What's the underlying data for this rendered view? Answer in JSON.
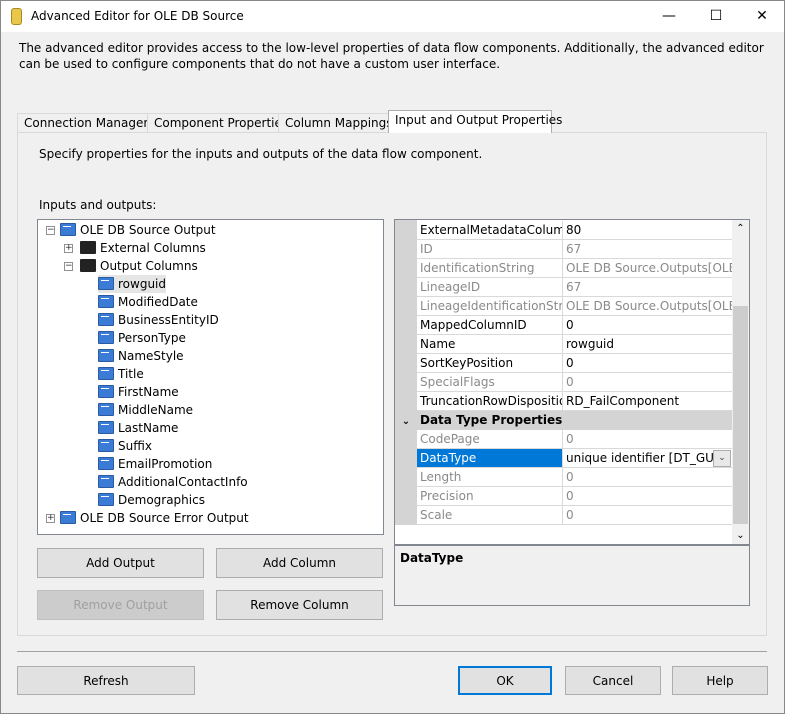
{
  "window": {
    "title": "Advanced Editor for OLE DB Source",
    "minimize": "—",
    "maximize": "☐",
    "close": "✕"
  },
  "description": "The advanced editor provides access to the low-level properties of data flow components. Additionally, the advanced editor can be used to configure components that do not have a custom user interface.",
  "tabs": [
    {
      "label": "Connection Managers"
    },
    {
      "label": "Component Properties"
    },
    {
      "label": "Column Mappings"
    },
    {
      "label": "Input and Output Properties",
      "active": true
    }
  ],
  "page": {
    "instruction": "Specify properties for the inputs and outputs of the data flow component.",
    "tree_label": "Inputs and outputs:"
  },
  "tree": {
    "output": "OLE DB Source Output",
    "external": "External Columns",
    "output_columns": "Output Columns",
    "columns": [
      "rowguid",
      "ModifiedDate",
      "BusinessEntityID",
      "PersonType",
      "NameStyle",
      "Title",
      "FirstName",
      "MiddleName",
      "LastName",
      "Suffix",
      "EmailPromotion",
      "AdditionalContactInfo",
      "Demographics"
    ],
    "error_output": "OLE DB Source Error Output",
    "selected": "rowguid"
  },
  "buttons": {
    "add_output": "Add Output",
    "add_column": "Add Column",
    "remove_output": "Remove Output",
    "remove_column": "Remove Column",
    "refresh": "Refresh",
    "ok": "OK",
    "cancel": "Cancel",
    "help": "Help"
  },
  "properties": [
    {
      "name": "ExternalMetadataColumnID",
      "value": "80",
      "readonly": false
    },
    {
      "name": "ID",
      "value": "67",
      "readonly": true
    },
    {
      "name": "IdentificationString",
      "value": "OLE DB Source.Outputs[OLE DB",
      "readonly": true
    },
    {
      "name": "LineageID",
      "value": "67",
      "readonly": true
    },
    {
      "name": "LineageIdentificationString",
      "value": "OLE DB Source.Outputs[OLE DB",
      "readonly": true
    },
    {
      "name": "MappedColumnID",
      "value": "0",
      "readonly": false
    },
    {
      "name": "Name",
      "value": "rowguid",
      "readonly": false
    },
    {
      "name": "SortKeyPosition",
      "value": "0",
      "readonly": false
    },
    {
      "name": "SpecialFlags",
      "value": "0",
      "readonly": true
    },
    {
      "name": "TruncationRowDisposition",
      "value": "RD_FailComponent",
      "readonly": false
    }
  ],
  "category": "Data Type Properties",
  "type_properties": [
    {
      "name": "CodePage",
      "value": "0",
      "readonly": true
    },
    {
      "name": "DataType",
      "value": "unique identifier [DT_GUID]",
      "readonly": false,
      "selected": true
    },
    {
      "name": "Length",
      "value": "0",
      "readonly": true
    },
    {
      "name": "Precision",
      "value": "0",
      "readonly": true
    },
    {
      "name": "Scale",
      "value": "0",
      "readonly": true
    }
  ],
  "property_description": "DataType",
  "colors": {
    "selection": "#0078d7",
    "accent": "#0078d7"
  }
}
